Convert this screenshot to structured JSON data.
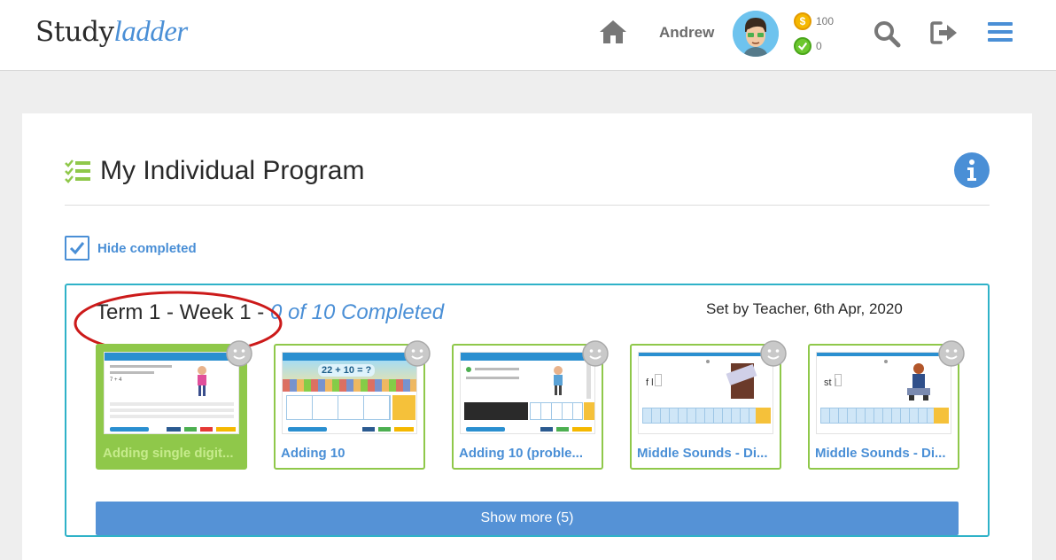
{
  "header": {
    "logo_part1": "Study",
    "logo_part2": "ladder",
    "username": "Andrew",
    "coins": "100",
    "completed_count": "0",
    "icons": [
      "home-icon",
      "avatar",
      "coin-icon",
      "check-icon",
      "search-icon",
      "logout-icon",
      "menu-icon"
    ]
  },
  "main": {
    "title": "My Individual Program",
    "hide_completed_label": "Hide completed",
    "hide_completed_checked": true
  },
  "term": {
    "title": "Term 1 - Week 1 - ",
    "progress": "0 of 10 Completed",
    "set_by": "Set by Teacher, 6th Apr, 2020",
    "activities": [
      {
        "label": "Adding single digit...",
        "completed": true,
        "thumb_text": "7 + 4"
      },
      {
        "label": "Adding 10",
        "completed": false,
        "thumb_text": "22 + 10 = ?"
      },
      {
        "label": "Adding 10 (proble...",
        "completed": false,
        "thumb_text": ""
      },
      {
        "label": "Middle Sounds - Di...",
        "completed": false,
        "thumb_text": "f l"
      },
      {
        "label": "Middle Sounds - Di...",
        "completed": false,
        "thumb_text": "st l"
      }
    ],
    "show_more_label": "Show more (5)"
  },
  "colors": {
    "accent_blue": "#4a8fd6",
    "panel_border": "#2fb2c8",
    "green": "#8fc84a",
    "red_annotation": "#cc1a1a"
  }
}
